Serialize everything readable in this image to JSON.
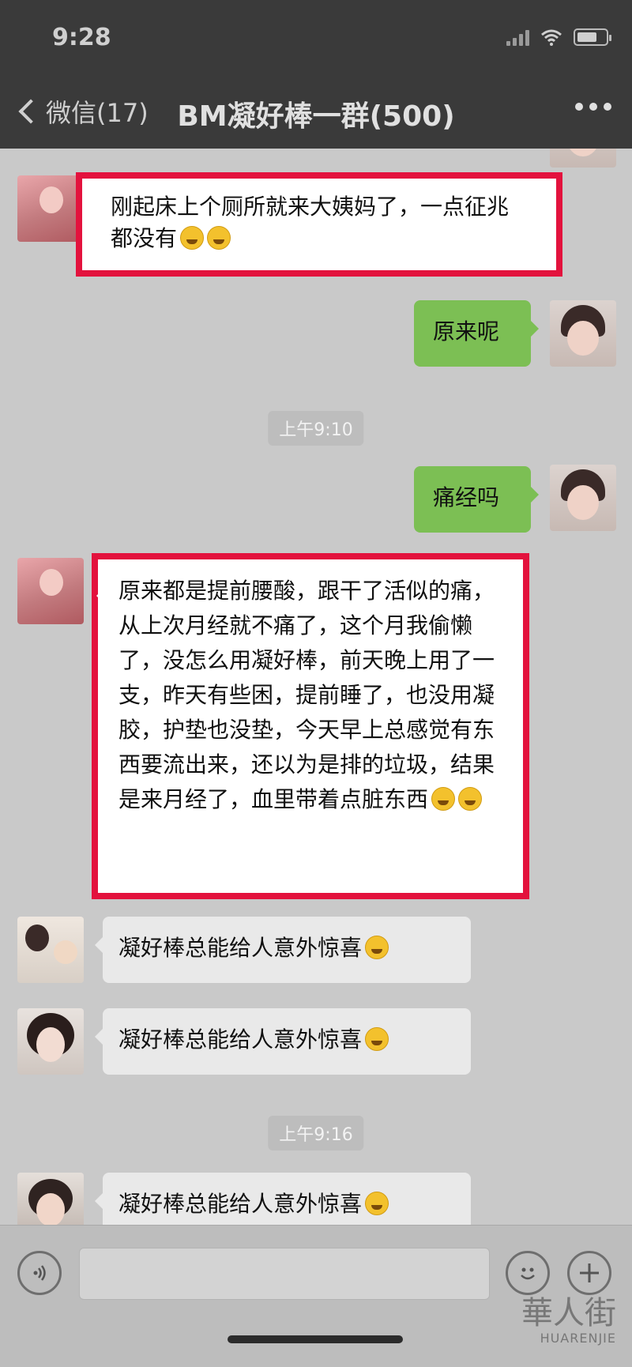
{
  "status_bar": {
    "time": "9:28"
  },
  "nav": {
    "back_label": "微信(17)",
    "title": "BM凝好棒一群(500)"
  },
  "messages": {
    "m1": "刚起床上个厕所就来大姨妈了，一点征兆都没有",
    "m2": "原来呢",
    "t1": "上午9:10",
    "m3": "痛经吗",
    "m4": "原来都是提前腰酸，跟干了活似的痛，从上次月经就不痛了，这个月我偷懒了，没怎么用凝好棒，前天晚上用了一支，昨天有些困，提前睡了，也没用凝胶，护垫也没垫，今天早上总感觉有东西要流出来，还以为是排的垃圾，结果是来月经了，血里带着点脏东西",
    "m5": "凝好棒总能给人意外惊喜",
    "m6": "凝好棒总能给人意外惊喜",
    "t2": "上午9:16",
    "m7": "凝好棒总能给人意外惊喜"
  },
  "watermark": {
    "cn": "華人街",
    "en": "HUARENJIE"
  },
  "colors": {
    "highlight": "#e3123d",
    "sent_bubble": "#7cbf54",
    "header": "#3a3a3a"
  }
}
